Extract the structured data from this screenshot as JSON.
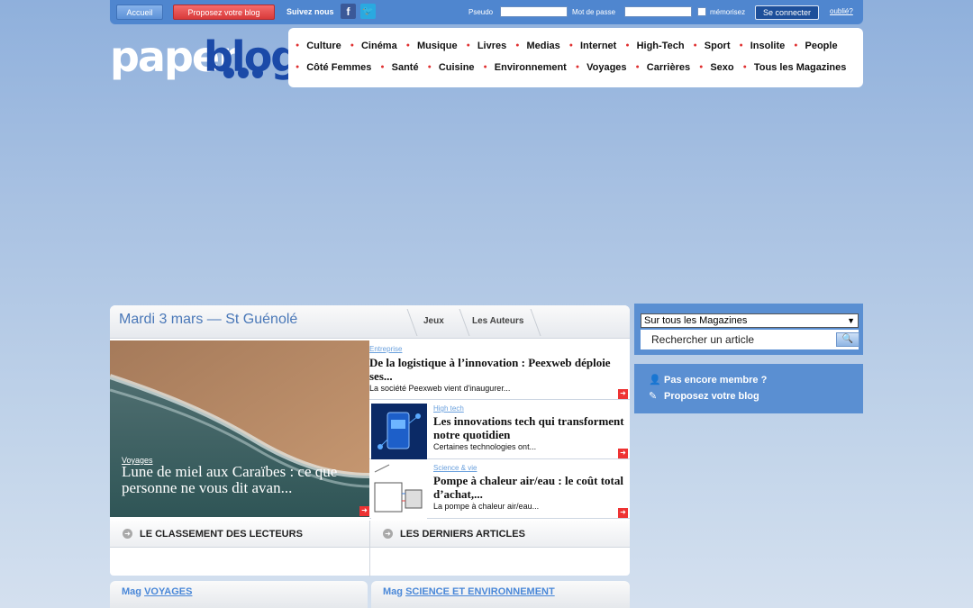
{
  "topbar": {
    "accueil_label": "Accueil",
    "propose_label": "Proposez votre blog",
    "suivez_label": "Suivez nous",
    "pseudo_label": "Pseudo",
    "mdp_label": "Mot de passe",
    "memoriser_label": "mémorisez",
    "connect_label": "Se connecter",
    "oublie_label": "oublié?"
  },
  "logo": {
    "paper": "paper",
    "blog": "blog"
  },
  "nav": {
    "row1": [
      "Culture",
      "Cinéma",
      "Musique",
      "Livres",
      "Medias",
      "Internet",
      "High-Tech",
      "Sport",
      "Insolite",
      "People"
    ],
    "row2": [
      "Côté Femmes",
      "Santé",
      "Cuisine",
      "Environnement",
      "Voyages",
      "Carrières",
      "Sexo",
      "Tous les Magazines"
    ]
  },
  "date_header": {
    "date": "Mardi 3 mars — St Guénolé",
    "tab1": "Jeux",
    "tab2": "Les Auteurs"
  },
  "featured": {
    "category": "Voyages",
    "title": "Lune de miel aux Caraïbes : ce que personne ne vous dit avan..."
  },
  "articles": [
    {
      "category": "Entreprise",
      "title": "De la logistique à l’innovation : Peexweb déploie ses...",
      "summary": "La société Peexweb vient d'inaugurer..."
    },
    {
      "category": "High tech",
      "title": "Les innovations tech qui transforment notre quotidien",
      "summary": "Certaines technologies ont..."
    },
    {
      "category": "Science & vie",
      "title": "Pompe à chaleur air/eau : le coût total d’achat,...",
      "summary": "La pompe à chaleur air/eau..."
    }
  ],
  "sections": {
    "classement": "LE CLASSEMENT DES LECTEURS",
    "derniers": "LES DERNIERS ARTICLES"
  },
  "mags": [
    {
      "prefix": "Mag",
      "name": "VOYAGES"
    },
    {
      "prefix": "Mag",
      "name": "SCIENCE ET ENVIRONNEMENT"
    }
  ],
  "sidebar": {
    "select_value": "Sur tous les Magazines",
    "search_placeholder": "Rechercher un article",
    "member_label": "Pas encore membre ?",
    "propose_label": "Proposez votre blog"
  },
  "colors": {
    "accent": "#4f86cf",
    "brand_blue": "#1b4aa8",
    "bullet_red": "#e03030"
  }
}
